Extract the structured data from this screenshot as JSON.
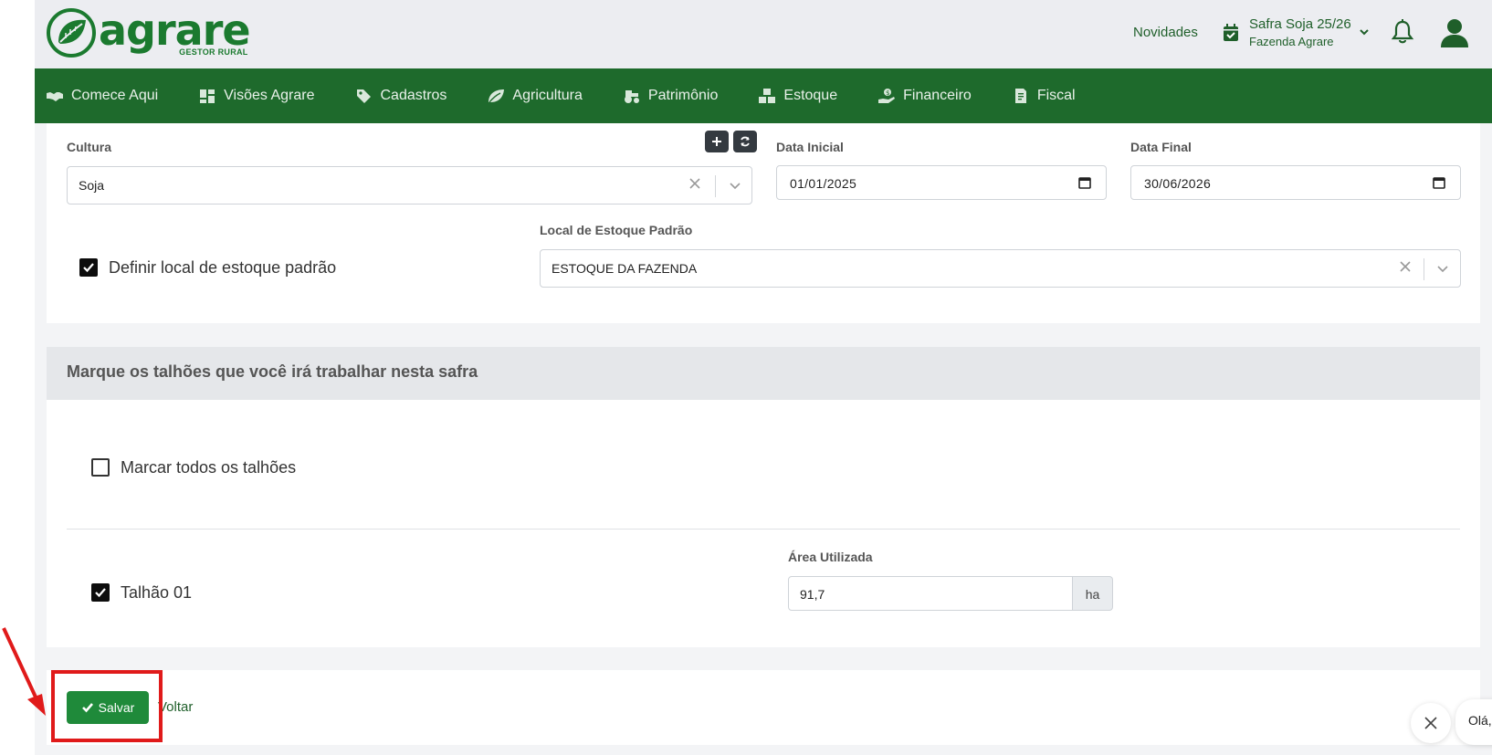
{
  "header": {
    "logo": {
      "word": "agrare",
      "sub": "GESTOR RURAL"
    },
    "novidades": "Novidades",
    "safra": {
      "name": "Safra Soja 25/26",
      "farm": "Fazenda Agrare"
    }
  },
  "nav": [
    {
      "label": "Comece Aqui",
      "icon": "handshake-icon"
    },
    {
      "label": "Visões Agrare",
      "icon": "dashboard-icon"
    },
    {
      "label": "Cadastros",
      "icon": "tags-icon"
    },
    {
      "label": "Agricultura",
      "icon": "leaf-icon"
    },
    {
      "label": "Patrimônio",
      "icon": "tractor-icon"
    },
    {
      "label": "Estoque",
      "icon": "boxes-icon"
    },
    {
      "label": "Financeiro",
      "icon": "hand-dollar-icon"
    },
    {
      "label": "Fiscal",
      "icon": "invoice-icon"
    }
  ],
  "form": {
    "cultura": {
      "label": "Cultura",
      "value": "Soja"
    },
    "data_inicial": {
      "label": "Data Inicial",
      "value": "01/01/2025"
    },
    "data_final": {
      "label": "Data Final",
      "value": "30/06/2026"
    },
    "definir_local": {
      "label": "Definir local de estoque padrão",
      "checked": true
    },
    "local_estoque": {
      "label": "Local de Estoque Padrão",
      "value": "ESTOQUE DA FAZENDA"
    }
  },
  "talhoes": {
    "title": "Marque os talhões que você irá trabalhar nesta safra",
    "marcar_todos": {
      "label": "Marcar todos os talhões",
      "checked": false
    },
    "items": [
      {
        "label": "Talhão 01",
        "checked": true,
        "area_label": "Área Utilizada",
        "area_value": "91,7",
        "unit": "ha"
      }
    ]
  },
  "actions": {
    "save": "Salvar",
    "back": "Voltar"
  },
  "chat": {
    "greeting": "Olá,"
  },
  "colors": {
    "brand_green": "#1e6a2c",
    "save_green": "#1f8a3a",
    "annotation_red": "#e01a1a"
  }
}
